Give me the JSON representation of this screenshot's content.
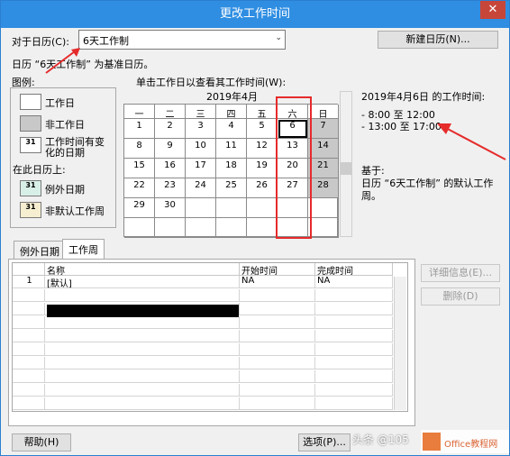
{
  "window": {
    "title": "更改工作时间",
    "close_glyph": "✕"
  },
  "for_calendar": {
    "label": "对于日历(C):",
    "value": "6天工作制",
    "dropdown_arrow": "⌄"
  },
  "new_calendar_button": "新建日历(N)...",
  "base_calendar_text": "日历 “6天工作制” 为基准日历。",
  "legend": {
    "title": "图例:",
    "items": [
      "工作日",
      "非工作日",
      "工作时间有变化的日期"
    ],
    "on_this_calendar": "在此日历上:",
    "items2": [
      "例外日期",
      "非默认工作周"
    ],
    "swatch_num": "31"
  },
  "calendar": {
    "instruction": "单击工作日以查看其工作时间(W):",
    "month": "2019年4月",
    "weekdays": [
      "一",
      "二",
      "三",
      "四",
      "五",
      "六",
      "日"
    ],
    "rows": [
      [
        "1",
        "2",
        "3",
        "4",
        "5",
        "6",
        "7"
      ],
      [
        "8",
        "9",
        "10",
        "11",
        "12",
        "13",
        "14"
      ],
      [
        "15",
        "16",
        "17",
        "18",
        "19",
        "20",
        "21"
      ],
      [
        "22",
        "23",
        "24",
        "25",
        "26",
        "27",
        "28"
      ],
      [
        "29",
        "30",
        "",
        "",
        "",
        "",
        ""
      ],
      [
        "",
        "",
        "",
        "",
        "",
        "",
        ""
      ]
    ]
  },
  "working_time": {
    "title": "2019年4月6日 的工作时间:",
    "lines": [
      "- 8:00 至 12:00",
      "- 13:00 至 17:00"
    ],
    "based_on": "基于:",
    "based_desc": "日历 “6天工作制” 的默认工作周。"
  },
  "tabs": {
    "exceptions": "例外日期",
    "work_weeks": "工作周"
  },
  "table": {
    "headers": [
      "名称",
      "开始时间",
      "完成时间"
    ],
    "rows": [
      [
        "1",
        "[默认]",
        "NA",
        "NA"
      ]
    ]
  },
  "detail_button": "详细信息(E)...",
  "delete_button": "删除(D)",
  "help_button": "帮助(H)",
  "options_button": "选项(P)...",
  "watermark": "头条 @105",
  "logo_text": "Office教程网"
}
